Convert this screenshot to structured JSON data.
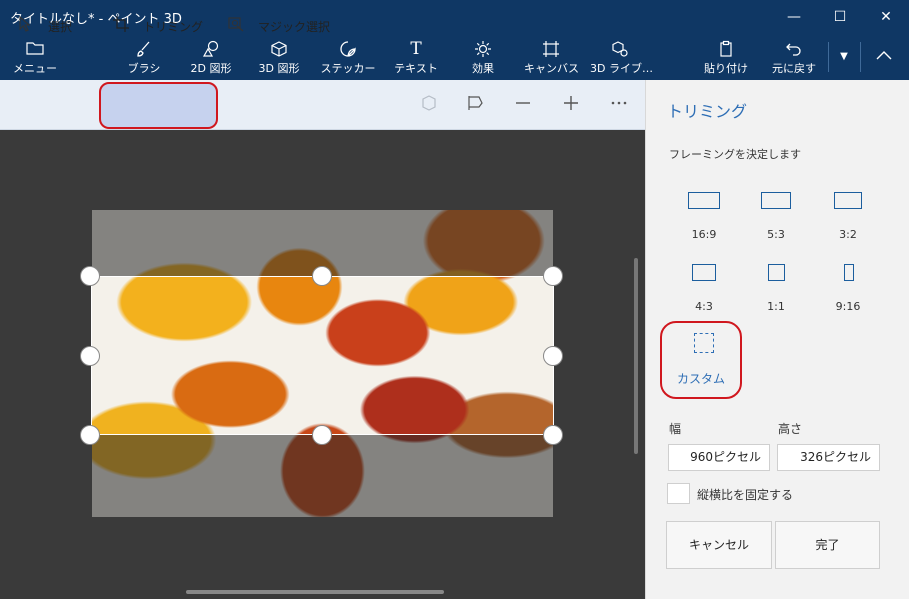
{
  "window": {
    "title": "タイトルなし* - ペイント 3D",
    "minimize_glyph": "—",
    "maximize_glyph": "☐",
    "close_glyph": "✕"
  },
  "toolbar": {
    "menu": {
      "label": "メニュー",
      "icon": "folder-icon"
    },
    "tools": [
      {
        "label": "ブラシ",
        "icon": "brush-icon"
      },
      {
        "label": "2D 図形",
        "icon": "2d-shapes-icon"
      },
      {
        "label": "3D 図形",
        "icon": "3d-shapes-icon"
      },
      {
        "label": "ステッカー",
        "icon": "sticker-icon"
      },
      {
        "label": "テキスト",
        "icon": "text-icon"
      },
      {
        "label": "効果",
        "icon": "effects-icon"
      },
      {
        "label": "キャンバス",
        "icon": "canvas-icon"
      },
      {
        "label": "3D ライブ…",
        "icon": "3d-library-icon"
      }
    ],
    "paste": {
      "label": "貼り付け",
      "icon": "paste-icon"
    },
    "undo": {
      "label": "元に戻す",
      "icon": "undo-icon"
    }
  },
  "subtoolbar": {
    "select_label": "選択",
    "crop_label": "トリミング",
    "magic_select_label": "マジック選択"
  },
  "panel": {
    "title": "トリミング",
    "subtitle": "フレーミングを決定します",
    "ratios": [
      "16:9",
      "5:3",
      "3:2",
      "4:3",
      "1:1",
      "9:16"
    ],
    "custom_label": "カスタム",
    "width_label": "幅",
    "height_label": "高さ",
    "width_value": "960ピクセル",
    "height_value": "326ピクセル",
    "lock_ratio_label": "縦横比を固定する",
    "cancel_label": "キャンセル",
    "done_label": "完了"
  },
  "colors": {
    "titlebar": "#0f3764",
    "accent": "#2e6eb5",
    "highlight_ring": "#d0171e",
    "active_tool": "#c6d2ee"
  }
}
